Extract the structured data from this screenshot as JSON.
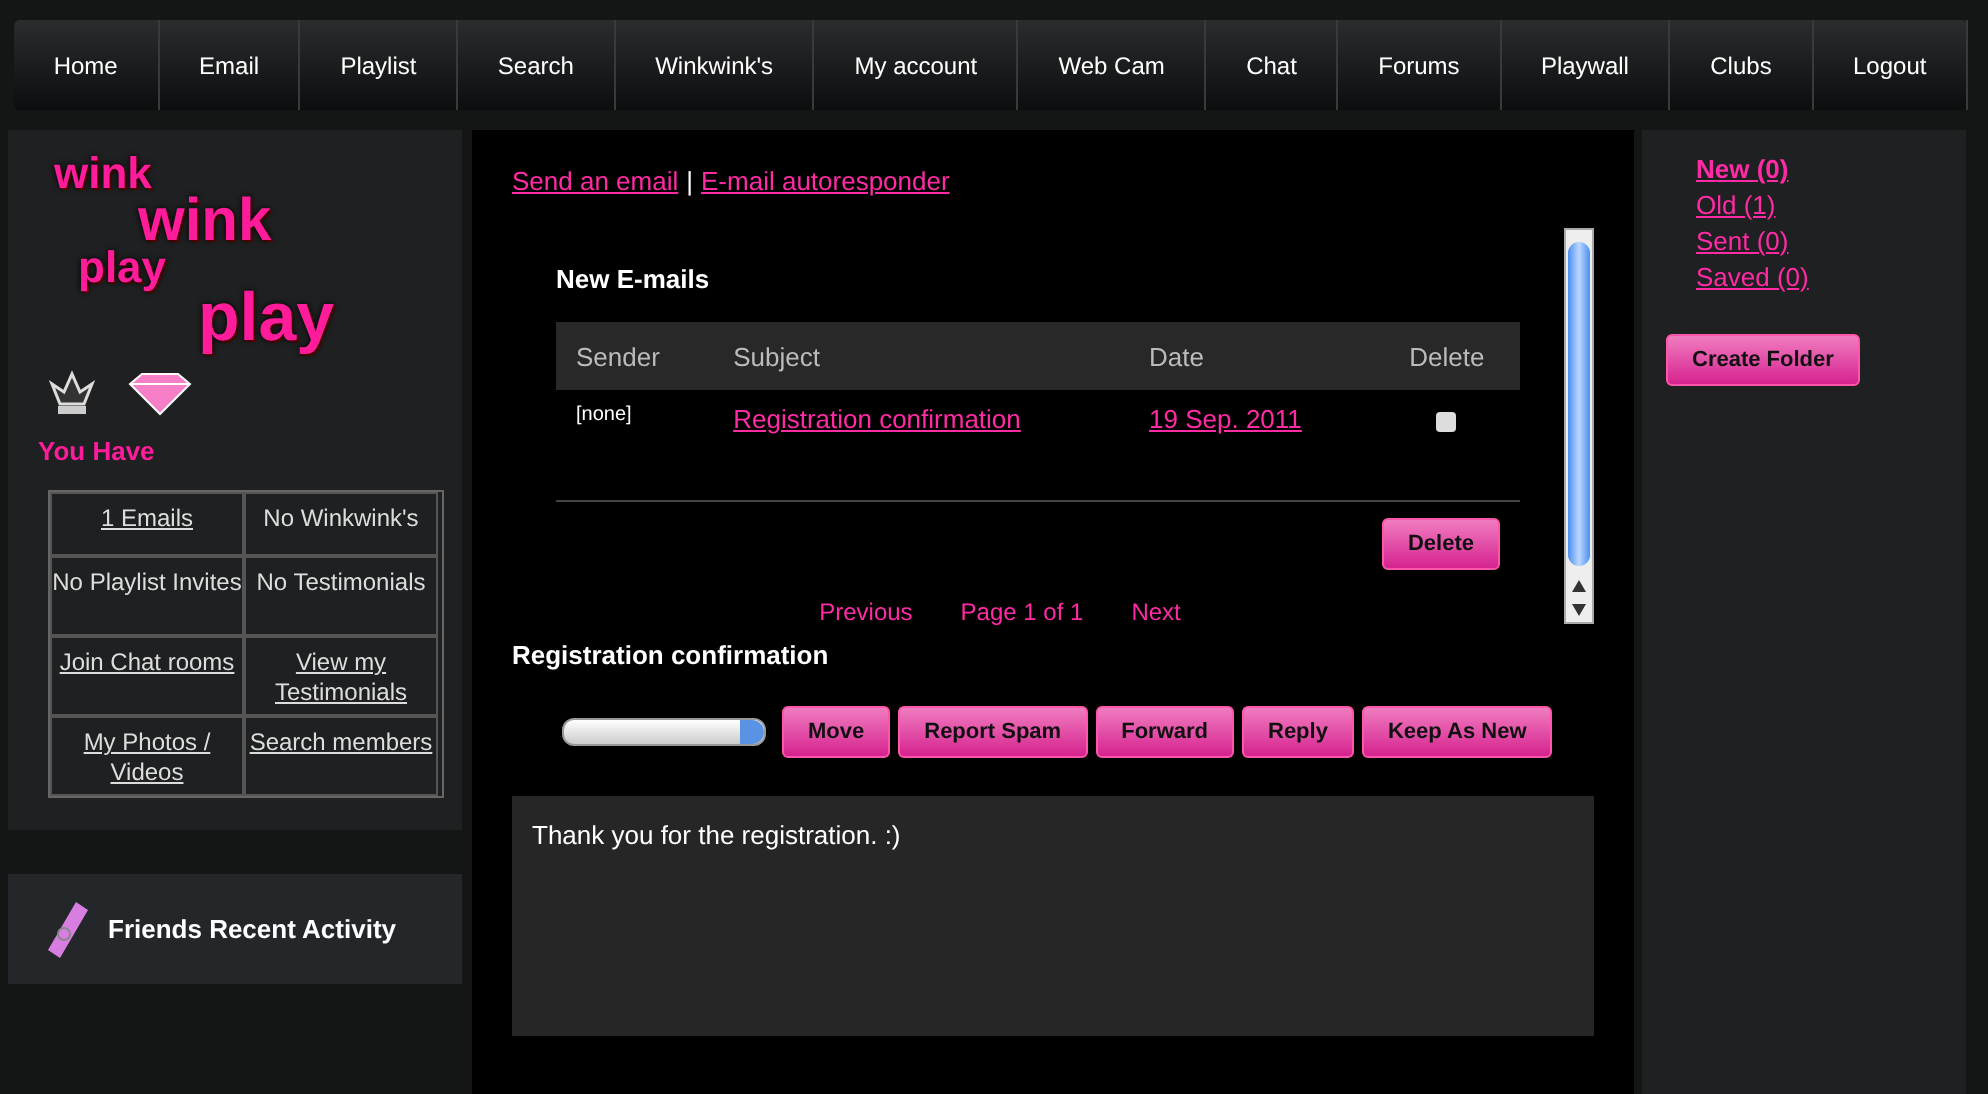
{
  "nav": [
    "Home",
    "Email",
    "Playlist",
    "Search",
    "Winkwink's",
    "My account",
    "Web Cam",
    "Chat",
    "Forums",
    "Playwall",
    "Clubs",
    "Logout"
  ],
  "logo": [
    "wink",
    "wink",
    "play",
    "play"
  ],
  "you_have": {
    "title": "You Have",
    "cells": [
      {
        "text": "1 Emails",
        "link": true
      },
      {
        "text": "No Winkwink's",
        "link": false
      },
      {
        "text": "No Playlist Invites",
        "link": false
      },
      {
        "text": "No Testimonials",
        "link": false
      },
      {
        "text": "Join Chat rooms",
        "link": true
      },
      {
        "text": "View my Testimonials",
        "link": true
      },
      {
        "text": "My Photos / Videos",
        "link": true
      },
      {
        "text": "Search members",
        "link": true
      }
    ]
  },
  "friends_activity": {
    "title": "Friends Recent Activity"
  },
  "top_links": [
    "Send an email",
    "E-mail autoresponder"
  ],
  "top_links_separator": "|",
  "inbox": {
    "title": "New E-mails",
    "columns": [
      "Sender",
      "Subject",
      "Date",
      "Delete"
    ],
    "rows": [
      {
        "sender": "[none]",
        "subject": "Registration confirmation",
        "date": "19 Sep. 2011",
        "checked": false
      }
    ],
    "delete_button": "Delete",
    "pagination": [
      "Previous",
      "Page 1 of 1",
      "Next"
    ]
  },
  "message": {
    "title": "Registration confirmation",
    "buttons": [
      "Move",
      "Report Spam",
      "Forward",
      "Reply",
      "Keep As New"
    ],
    "body": "Thank you for the registration. :)"
  },
  "folders": [
    {
      "label": "New (0)",
      "selected": true
    },
    {
      "label": "Old (1)",
      "selected": false
    },
    {
      "label": "Sent (0)",
      "selected": false
    },
    {
      "label": "Saved (0)",
      "selected": false
    }
  ],
  "create_folder": "Create Folder"
}
